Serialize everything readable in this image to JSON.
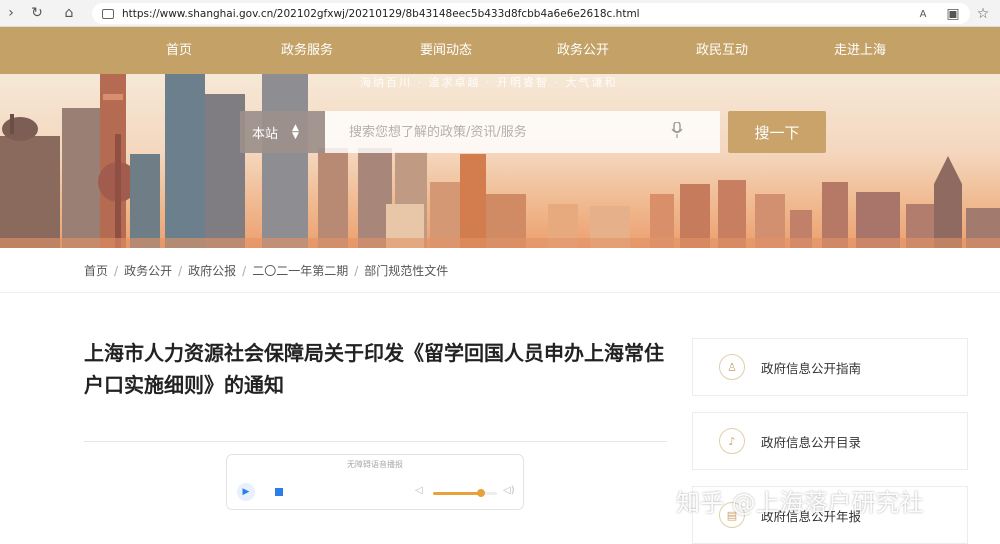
{
  "browser": {
    "url": "https://www.shanghai.gov.cn/202102gfxwj/20210129/8b43148eec5b433d8fcbb4a6e6e2618c.html"
  },
  "nav": {
    "items": [
      "首页",
      "政务服务",
      "要闻动态",
      "政务公开",
      "政民互动",
      "走进上海"
    ],
    "active": "政务公开"
  },
  "banner": {
    "slogan": "海纳百川 · 追求卓越 · 开明睿智 · 大气谦和",
    "scope": "本站",
    "search_placeholder": "搜索您想了解的政策/资讯/服务",
    "search_button": "搜一下"
  },
  "breadcrumb": [
    "首页",
    "政务公开",
    "政府公报",
    "二〇二一年第二期",
    "部门规范性文件"
  ],
  "article": {
    "title": "上海市人力资源社会保障局关于印发《留学回国人员申办上海常住户口实施细则》的通知"
  },
  "player": {
    "label": "无障碍语音播报",
    "volume": 0.75
  },
  "side_panel": {
    "items": [
      "政府信息公开指南",
      "政府信息公开目录",
      "政府信息公开年报"
    ]
  },
  "watermark": "知乎 @上海落户研究社",
  "colors": {
    "nav_bg": "#c4a267",
    "accent": "#c9a36a",
    "player_blue": "#2b7de9",
    "slider": "#e9a13c"
  }
}
